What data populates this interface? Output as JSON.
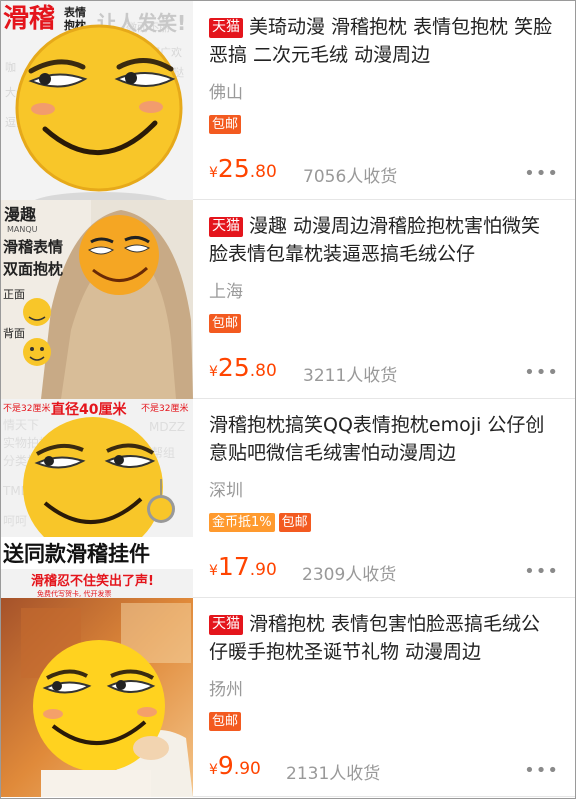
{
  "products": [
    {
      "badge": "天猫",
      "title": "美琦动漫 滑稽抱枕 表情包抱枕 笑脸恶搞 二次元毛绒 动漫周边",
      "location": "佛山",
      "tags": [
        "包邮"
      ],
      "price_currency": "¥",
      "price_int": "25",
      "price_dec": ".80",
      "sales": "7056人收货",
      "more": "•••",
      "image_text": {
        "brand": "滑稽",
        "sub1": "表情",
        "sub2": "抱枕",
        "slogan": "让人发笑!"
      }
    },
    {
      "badge": "天猫",
      "title": "漫趣 动漫周边滑稽脸抱枕害怕微笑脸表情包靠枕装逼恶搞毛绒公仔",
      "location": "上海",
      "tags": [
        "包邮"
      ],
      "price_currency": "¥",
      "price_int": "25",
      "price_dec": ".80",
      "sales": "3211人收货",
      "more": "•••",
      "image_text": {
        "brand": "漫趣",
        "line1": "滑稽表情",
        "line2": "双面抱枕",
        "front": "正面",
        "back": "背面"
      }
    },
    {
      "badge": "",
      "title": "滑稽抱枕搞笑QQ表情抱枕emoji 公仔创意贴吧微信毛绒害怕动漫周边",
      "location": "深圳",
      "tags": [
        "金币抵1%",
        "包邮"
      ],
      "price_currency": "¥",
      "price_int": "17",
      "price_dec": ".90",
      "sales": "2309人收货",
      "more": "•••",
      "image_text": {
        "size": "直径40厘米",
        "note_left": "不是32厘米",
        "note_right": "不是32厘米",
        "banner": "送同款滑稽挂件",
        "bottom": "滑稽忍不住笑出了声!",
        "bottom_sub": "免费代写贺卡, 代开发票"
      }
    },
    {
      "badge": "天猫",
      "title": "滑稽抱枕 表情包害怕脸恶搞毛绒公仔暖手抱枕圣诞节礼物 动漫周边",
      "location": "扬州",
      "tags": [
        "包邮"
      ],
      "price_currency": "¥",
      "price_int": "9",
      "price_dec": ".90",
      "sales": "2131人收货",
      "more": "•••",
      "image_text": {}
    }
  ],
  "colors": {
    "price": "#ff4400",
    "tmall": "#e4151c",
    "free_shipping": "#f35a20",
    "coin": "#ff9a2e",
    "face": "#f8c629"
  }
}
